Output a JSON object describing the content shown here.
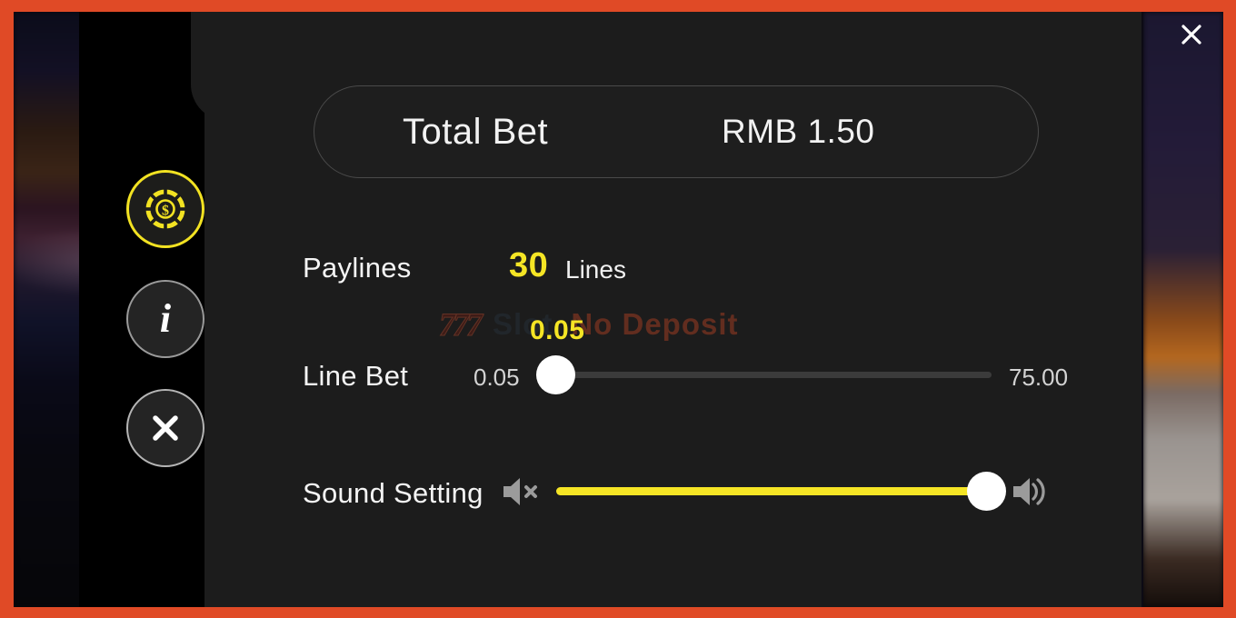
{
  "window": {
    "close_icon": "close-icon",
    "frame_color": "#e04a26"
  },
  "sidebar": {
    "items": [
      {
        "id": "bet-settings",
        "icon": "casino-chip-icon",
        "active": true,
        "accent": "#f2e222"
      },
      {
        "id": "info",
        "icon": "info-icon",
        "active": false,
        "glyph": "i"
      },
      {
        "id": "close-panel",
        "icon": "close-icon",
        "active": false
      }
    ]
  },
  "panel": {
    "total_bet": {
      "label": "Total Bet",
      "value": "RMB 1.50"
    },
    "paylines": {
      "label": "Paylines",
      "count": "30",
      "unit": "Lines",
      "accent": "#f5e525"
    },
    "line_bet": {
      "label": "Line Bet",
      "min": "0.05",
      "max": "75.00",
      "value": "0.05",
      "fill_percent": 0,
      "accent": "#f5e525"
    },
    "sound_setting": {
      "label": "Sound Setting",
      "mute_icon": "speaker-mute-icon",
      "volume_icon": "speaker-on-icon",
      "fill_percent": 100,
      "accent": "#f5e525"
    }
  },
  "watermark": {
    "seven": "777",
    "slot": "Slot",
    "no_deposit": "No Deposit"
  }
}
